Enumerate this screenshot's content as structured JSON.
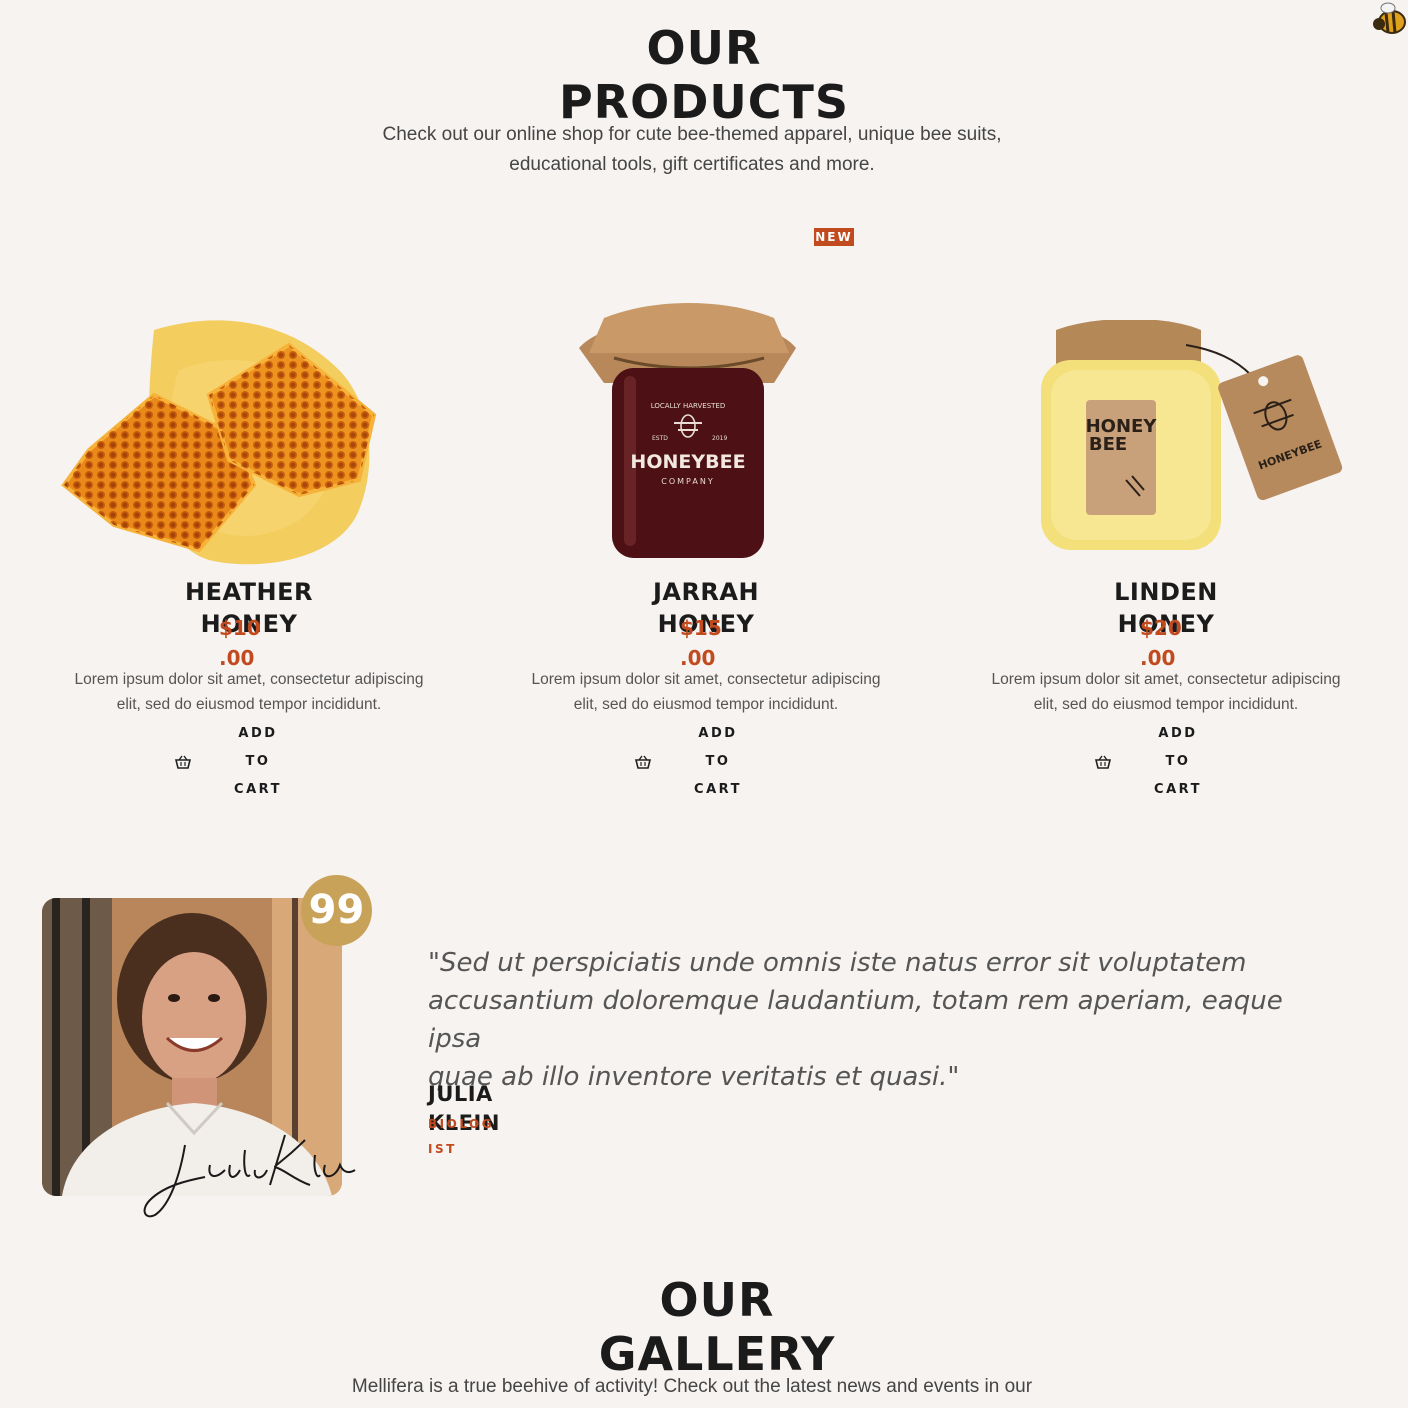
{
  "products_section": {
    "title_line1": "OUR",
    "title_line2": "PRODUCTS",
    "subtitle_line1": "Check out our online shop for cute bee-themed apparel, unique bee suits,",
    "subtitle_line2": "educational tools, gift certificates and more.",
    "new_badge": "NEW",
    "items": [
      {
        "name_line1": "HEATHER",
        "name_line2": "HONEY",
        "price_line1": "$10",
        "price_line2": ".00",
        "desc_line1": "Lorem ipsum dolor sit amet, consectetur adipiscing",
        "desc_line2": "elit, sed do eiusmod tempor incididunt.",
        "cart_line1": "ADD TO",
        "cart_line2": "CART",
        "image": "honeycomb"
      },
      {
        "name_line1": "JARRAH",
        "name_line2": "HONEY",
        "price_line1": "$15",
        "price_line2": ".00",
        "desc_line1": "Lorem ipsum dolor sit amet, consectetur adipiscing",
        "desc_line2": "elit, sed do eiusmod tempor incididunt.",
        "cart_line1": "ADD TO",
        "cart_line2": "CART",
        "image": "dark-honey-jar",
        "jar_label_top": "LOCALLY HARVESTED",
        "jar_label_estd": "ESTD",
        "jar_label_year": "2019",
        "jar_label_brand": "HONEYBEE",
        "jar_label_company": "COMPANY"
      },
      {
        "name_line1": "LINDEN",
        "name_line2": "HONEY",
        "price_line1": "$20",
        "price_line2": ".00",
        "desc_line1": "Lorem ipsum dolor sit amet, consectetur adipiscing",
        "desc_line2": "elit, sed do eiusmod tempor incididunt.",
        "cart_line1": "ADD TO",
        "cart_line2": "CART",
        "image": "cream-honey-jar",
        "jar_label_line1": "HONEY",
        "jar_label_line2": "BEE",
        "tag_label": "HONEYBEE"
      }
    ]
  },
  "testimonial": {
    "quote_badge": "99",
    "quote_line1": "\"Sed ut perspiciatis unde omnis iste natus error sit voluptatem",
    "quote_line2": "accusantium doloremque laudantium, totam rem aperiam, eaque ipsa",
    "quote_line3": "quae ab illo inventore veritatis et quasi.\"",
    "author_line1": "JULIA",
    "author_line2": "KLEIN",
    "role_line1": "BIOLOG",
    "role_line2": "IST",
    "signature": "Julia Klein"
  },
  "gallery_section": {
    "title_line1": "OUR",
    "title_line2": "GALLERY",
    "subtitle_line1": "Mellifera is a true beehive of activity! Check out the latest news and events in our"
  },
  "colors": {
    "background": "#f6f3f1",
    "accent": "#c14a1e",
    "gold": "#c9a25a",
    "heading": "#1b1b1b"
  },
  "icons": [
    "basket-icon",
    "quote-icon",
    "bee-icon"
  ]
}
